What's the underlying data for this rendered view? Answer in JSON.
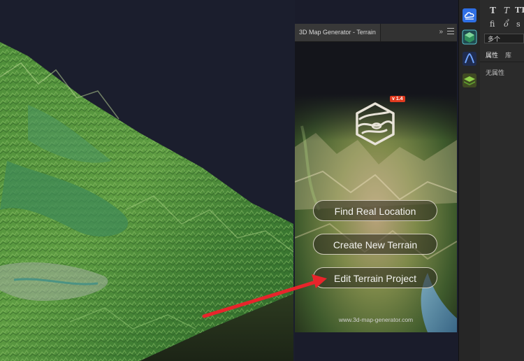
{
  "plugin": {
    "tab_title": "3D Map Generator - Terrain",
    "collapse_glyph": "»",
    "version_badge": "v 1.4",
    "buttons": {
      "find": "Find Real Location",
      "create": "Create New Terrain",
      "edit": "Edit Terrain Project"
    },
    "website": "www.3d-map-generator.com"
  },
  "right_panel": {
    "typography_glyphs": [
      "T",
      "T",
      "TT",
      "fi",
      "ổ",
      "s"
    ],
    "font_select": "多个",
    "tabs": {
      "properties": "属性",
      "library": "库"
    },
    "empty_message": "无属性"
  },
  "icon_column": {
    "icons": [
      "cloud-app-icon",
      "terrain-cube-icon",
      "curve-a-icon",
      "layer-stack-icon"
    ]
  },
  "colors": {
    "accent_red": "#e03a1f",
    "annotation_arrow": "#e8242b",
    "canvas_bg": "#1b1e2d"
  }
}
